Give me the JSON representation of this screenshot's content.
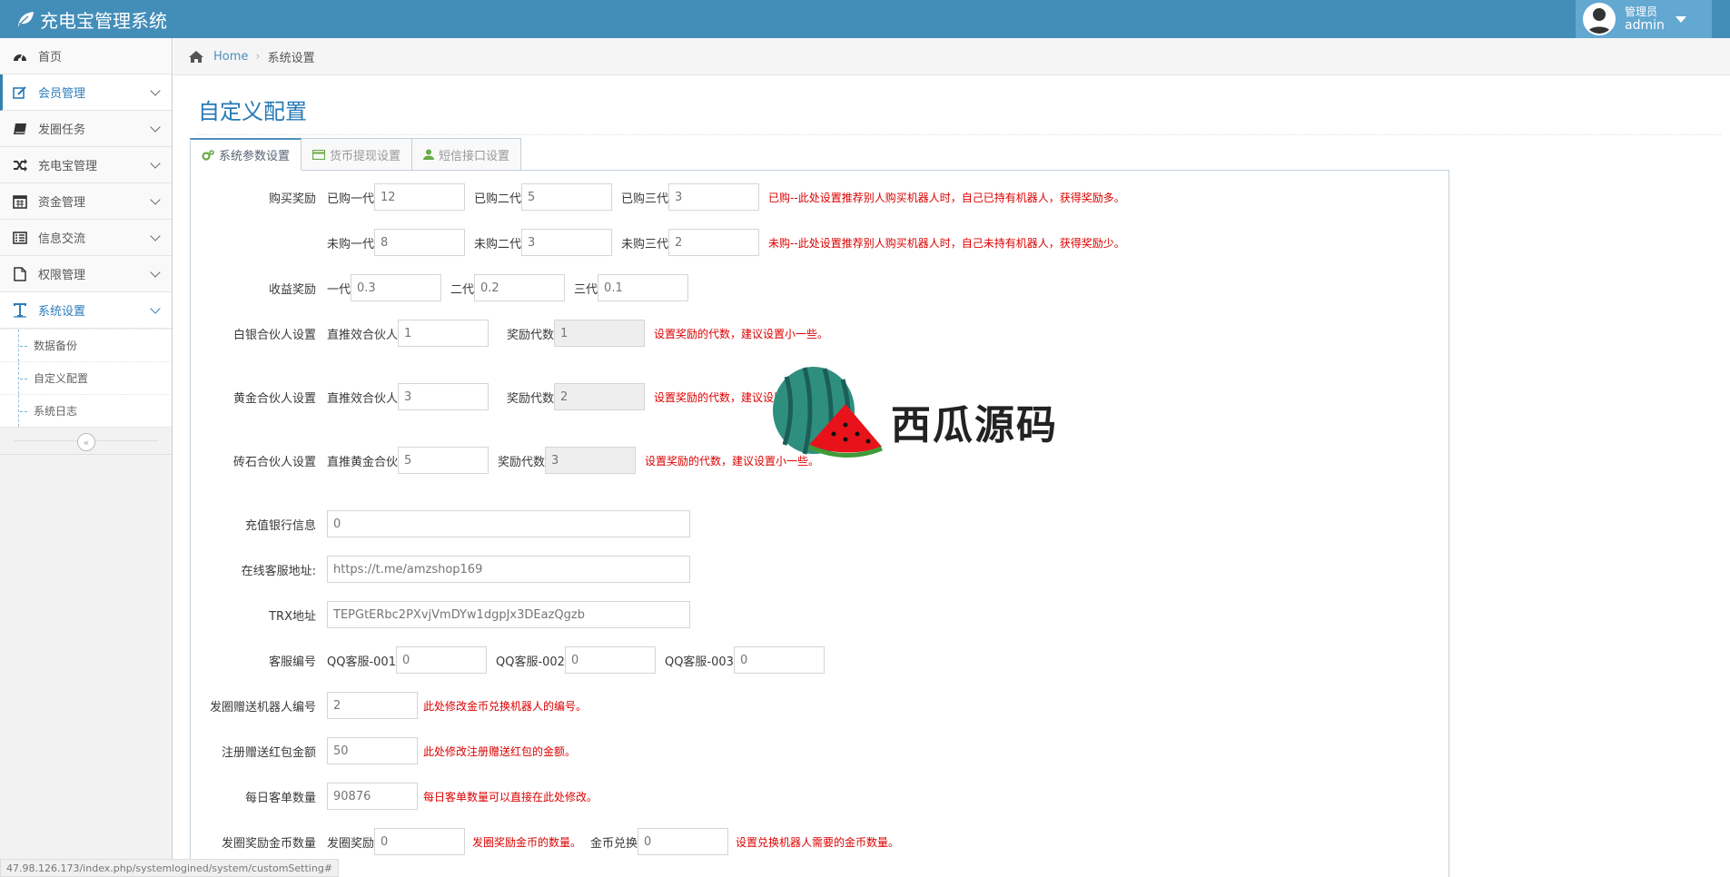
{
  "app": {
    "title": "充电宝管理系统"
  },
  "user": {
    "welcome": "管理员",
    "name": "admin"
  },
  "sidebar": {
    "items": [
      {
        "label": "首页",
        "icon": "dashboard-icon"
      },
      {
        "label": "会员管理",
        "icon": "edit-icon"
      },
      {
        "label": "发圈任务",
        "icon": "book-icon"
      },
      {
        "label": "充电宝管理",
        "icon": "random-icon"
      },
      {
        "label": "资金管理",
        "icon": "calendar-icon"
      },
      {
        "label": "信息交流",
        "icon": "list-icon"
      },
      {
        "label": "权限管理",
        "icon": "file-icon"
      },
      {
        "label": "系统设置",
        "icon": "text-icon"
      }
    ],
    "submenu": [
      "数据备份",
      "自定义配置",
      "系统日志"
    ],
    "collapse": "«"
  },
  "breadcrumb": {
    "home": "Home",
    "current": "系统设置"
  },
  "page": {
    "title": "自定义配置"
  },
  "tabs": [
    {
      "label": "系统参数设置"
    },
    {
      "label": "货币提现设置"
    },
    {
      "label": "短信接口设置"
    }
  ],
  "form": {
    "buy_reward": {
      "label": "购买奖励",
      "bought": {
        "l1": "已购一代",
        "v1": "12",
        "l2": "已购二代",
        "v2": "5",
        "l3": "已购三代",
        "v3": "3",
        "hint": "已购--此处设置推荐别人购买机器人时，自己已持有机器人，获得奖励多。"
      },
      "not_bought": {
        "l1": "未购一代",
        "v1": "8",
        "l2": "未购二代",
        "v2": "3",
        "l3": "未购三代",
        "v3": "2",
        "hint": "未购--此处设置推荐别人购买机器人时，自己未持有机器人，获得奖励少。"
      }
    },
    "income_reward": {
      "label": "收益奖励",
      "l1": "一代",
      "v1": "0.3",
      "l2": "二代",
      "v2": "0.2",
      "l3": "三代",
      "v3": "0.1"
    },
    "silver": {
      "label": "白银合伙人设置",
      "l1": "直推效合伙人",
      "v1": "1",
      "l2": "奖励代数",
      "v2": "1",
      "hint": "设置奖励的代数，建议设置小一些。"
    },
    "gold": {
      "label": "黄金合伙人设置",
      "l1": "直推效合伙人",
      "v1": "3",
      "l2": "奖励代数",
      "v2": "2",
      "hint": "设置奖励的代数，建议设置小一些。"
    },
    "diamond": {
      "label": "砖石合伙人设置",
      "l1": "直推黄金合伙",
      "v1": "5",
      "l2": "奖励代数",
      "v2": "3",
      "hint": "设置奖励的代数，建议设置小一些。"
    },
    "bank": {
      "label": "充值银行信息",
      "value": "0"
    },
    "service_url": {
      "label": "在线客服地址:",
      "value": "https://t.me/amzshop169"
    },
    "trx": {
      "label": "TRX地址",
      "value": "TEPGtERbc2PXvjVmDYw1dgpJx3DEazQgzb"
    },
    "service_no": {
      "label": "客服编号",
      "l1": "QQ客服-001",
      "v1": "0",
      "l2": "QQ客服-002",
      "v2": "0",
      "l3": "QQ客服-003",
      "v3": "0"
    },
    "gift_robot": {
      "label": "发圈赠送机器人编号",
      "value": "2",
      "hint": "此处修改金币兑换机器人的编号。"
    },
    "reg_bonus": {
      "label": "注册赠送红包金额",
      "value": "50",
      "hint": "此处修改注册赠送红包的金额。"
    },
    "daily_orders": {
      "label": "每日客单数量",
      "value": "90876",
      "hint": "每日客单数量可以直接在此处修改。"
    },
    "coin_reward": {
      "label": "发圈奖励金币数量",
      "l1": "发圈奖励",
      "v1": "0",
      "hint1": "发圈奖励金币的数量。",
      "l2": "金币兑换",
      "v2": "0",
      "hint2": "设置兑换机器人需要的金币数量。"
    }
  },
  "watermark": {
    "text": "西瓜源码"
  },
  "status_url": "47.98.126.173/index.php/systemlogined/system/customSetting#"
}
